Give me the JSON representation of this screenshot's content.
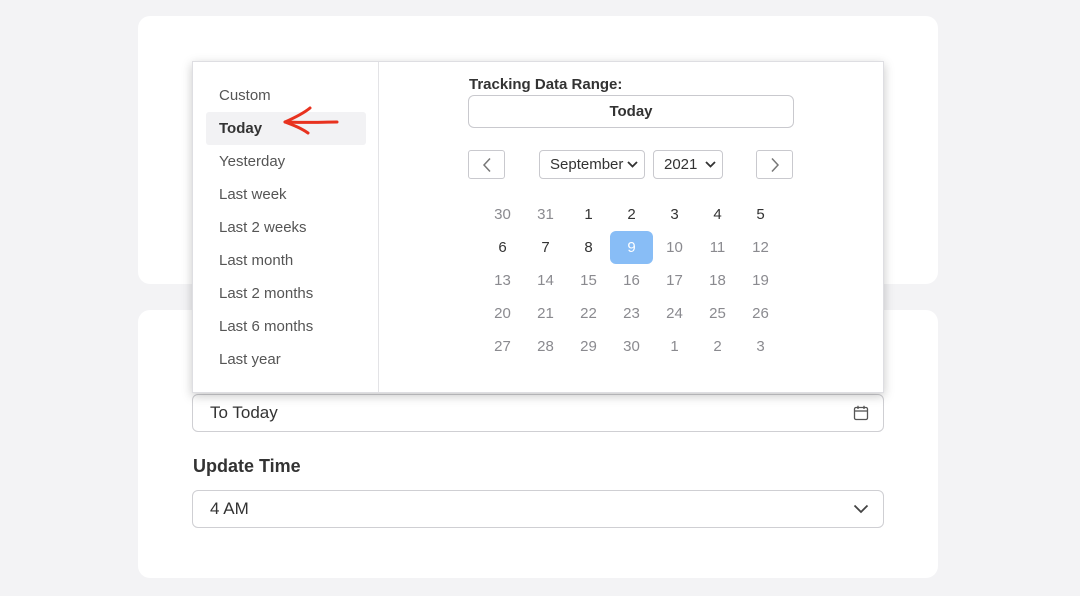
{
  "popup": {
    "presets": [
      "Custom",
      "Today",
      "Yesterday",
      "Last week",
      "Last 2 weeks",
      "Last month",
      "Last 2 months",
      "Last 6 months",
      "Last year"
    ],
    "active_preset": "Today",
    "range_label": "Tracking Data Range:",
    "range_value": "Today",
    "month": "September",
    "year": "2021",
    "days": [
      {
        "d": "30",
        "state": "other"
      },
      {
        "d": "31",
        "state": "other"
      },
      {
        "d": "1",
        "state": "cur"
      },
      {
        "d": "2",
        "state": "cur"
      },
      {
        "d": "3",
        "state": "cur"
      },
      {
        "d": "4",
        "state": "cur"
      },
      {
        "d": "5",
        "state": "cur"
      },
      {
        "d": "6",
        "state": "cur"
      },
      {
        "d": "7",
        "state": "cur"
      },
      {
        "d": "8",
        "state": "cur"
      },
      {
        "d": "9",
        "state": "sel"
      },
      {
        "d": "10",
        "state": "other"
      },
      {
        "d": "11",
        "state": "other"
      },
      {
        "d": "12",
        "state": "other"
      },
      {
        "d": "13",
        "state": "other"
      },
      {
        "d": "14",
        "state": "other"
      },
      {
        "d": "15",
        "state": "other"
      },
      {
        "d": "16",
        "state": "other"
      },
      {
        "d": "17",
        "state": "other"
      },
      {
        "d": "18",
        "state": "other"
      },
      {
        "d": "19",
        "state": "other"
      },
      {
        "d": "20",
        "state": "other"
      },
      {
        "d": "21",
        "state": "other"
      },
      {
        "d": "22",
        "state": "other"
      },
      {
        "d": "23",
        "state": "other"
      },
      {
        "d": "24",
        "state": "other"
      },
      {
        "d": "25",
        "state": "other"
      },
      {
        "d": "26",
        "state": "other"
      },
      {
        "d": "27",
        "state": "other"
      },
      {
        "d": "28",
        "state": "other"
      },
      {
        "d": "29",
        "state": "other"
      },
      {
        "d": "30",
        "state": "other"
      },
      {
        "d": "1",
        "state": "other"
      },
      {
        "d": "2",
        "state": "other"
      },
      {
        "d": "3",
        "state": "other"
      }
    ]
  },
  "date_field": {
    "value": "To Today",
    "icon": "calendar-icon"
  },
  "update_time": {
    "label": "Update Time",
    "value": "4 AM",
    "icon": "chevron-down-icon"
  },
  "colors": {
    "selected_day": "#88bdf6",
    "annotation": "#e8321f"
  }
}
